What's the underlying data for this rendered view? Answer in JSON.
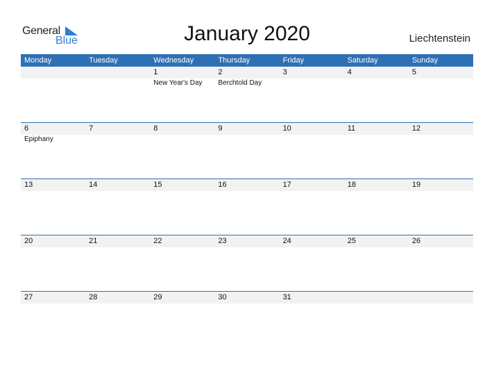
{
  "logo": {
    "word1": "General",
    "word2": "Blue"
  },
  "title": "January 2020",
  "country": "Liechtenstein",
  "colors": {
    "header_bg": "#2e70b4",
    "row_bg": "#f2f2f2",
    "brand_blue": "#2a7fd4"
  },
  "weekdays": [
    "Monday",
    "Tuesday",
    "Wednesday",
    "Thursday",
    "Friday",
    "Saturday",
    "Sunday"
  ],
  "weeks": [
    {
      "days": [
        "",
        "",
        "1",
        "2",
        "3",
        "4",
        "5"
      ],
      "events": [
        "",
        "",
        "New Year's Day",
        "Berchtold Day",
        "",
        "",
        ""
      ]
    },
    {
      "days": [
        "6",
        "7",
        "8",
        "9",
        "10",
        "11",
        "12"
      ],
      "events": [
        "Epiphany",
        "",
        "",
        "",
        "",
        "",
        ""
      ]
    },
    {
      "days": [
        "13",
        "14",
        "15",
        "16",
        "17",
        "18",
        "19"
      ],
      "events": [
        "",
        "",
        "",
        "",
        "",
        "",
        ""
      ]
    },
    {
      "days": [
        "20",
        "21",
        "22",
        "23",
        "24",
        "25",
        "26"
      ],
      "events": [
        "",
        "",
        "",
        "",
        "",
        "",
        ""
      ]
    },
    {
      "days": [
        "27",
        "28",
        "29",
        "30",
        "31",
        "",
        ""
      ],
      "events": [
        "",
        "",
        "",
        "",
        "",
        "",
        ""
      ]
    }
  ]
}
